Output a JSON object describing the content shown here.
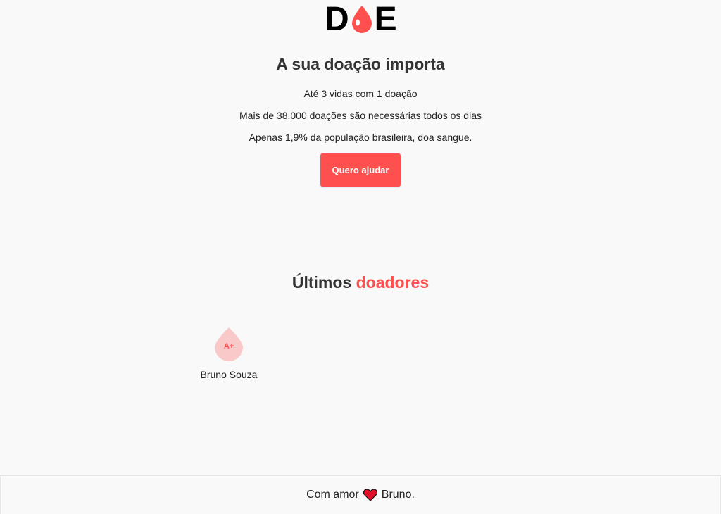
{
  "logo": {
    "letter_left": "D",
    "letter_right": "E",
    "drop_icon": "blood-drop-icon",
    "drop_color": "#ff4f4f"
  },
  "hero": {
    "title": "A sua doação importa",
    "lines": [
      "Até 3 vidas com 1 doação",
      "Mais de 38.000 doações são necessárias todos os dias",
      "Apenas 1,9% da população brasileira, doa sangue."
    ],
    "cta_label": "Quero ajudar"
  },
  "donors": {
    "title_prefix": "Últimos",
    "title_accent": "doadores",
    "list": [
      {
        "blood_type": "A+",
        "name": "Bruno Souza"
      }
    ]
  },
  "footer": {
    "prefix": "Com amor",
    "heart_icon": "heart-icon",
    "suffix": "Bruno."
  },
  "colors": {
    "accent": "#ff4f4f",
    "drop_light": "#f9c9c9",
    "background": "#f9f9f9",
    "text": "#222222"
  }
}
